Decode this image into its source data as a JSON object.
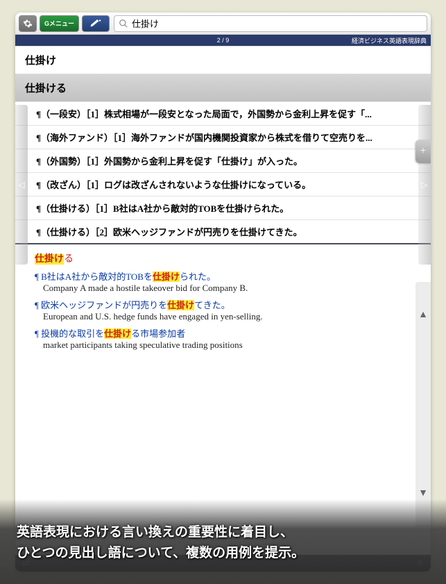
{
  "toolbar": {
    "menu_label": "Gメニュー"
  },
  "search": {
    "value": "仕掛け"
  },
  "status": {
    "position": "2 / 9",
    "dict_name": "経済ビジネス英語表現辞典"
  },
  "headwords": [
    {
      "text": "仕掛け",
      "selected": false
    },
    {
      "text": "仕掛ける",
      "selected": true
    }
  ],
  "results": [
    "¶（一段安）［1］株式相場が一段安となった局面で，外国勢から金利上昇を促す「...",
    "¶（海外ファンド）［1］海外ファンドが国内機関投資家から株式を借りて空売りを...",
    "¶（外国勢）［1］外国勢から金利上昇を促す「仕掛け」が入った。",
    "¶（改ざん）［1］ログは改ざんされないような仕掛けになっている。",
    "¶（仕掛ける）［1］B社はA社から敵対的TOBを仕掛けられた。",
    "¶（仕掛ける）［2］欧米ヘッジファンドが円売りを仕掛けてきた。"
  ],
  "detail": {
    "hw_hl": "仕掛け",
    "hw_tail": "る",
    "senses": [
      {
        "jp_pre": "B社はA社から敵対的TOBを",
        "jp_hl": "仕掛け",
        "jp_post": "られた。",
        "en": "Company A made a hostile takeover bid for Company B."
      },
      {
        "jp_pre": "欧米ヘッジファンドが円売りを",
        "jp_hl": "仕掛け",
        "jp_post": "てきた。",
        "en": "European and U.S. hedge funds have engaged in yen-selling."
      },
      {
        "jp_pre": "投機的な取引を",
        "jp_hl": "仕掛け",
        "jp_post": "る市場参加者",
        "en": "market participants taking speculative trading positions"
      }
    ]
  },
  "overlay": {
    "line1": "英語表現における言い換えの重要性に着目し、",
    "line2": "ひとつの見出し語について、複数の用例を提示。"
  }
}
